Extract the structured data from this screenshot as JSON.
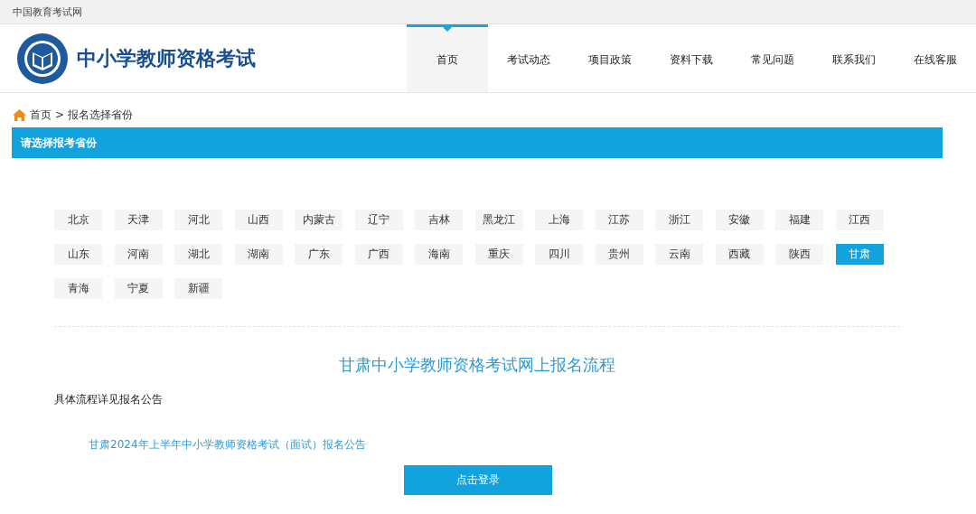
{
  "top_bar": {
    "site_name": "中国教育考试网"
  },
  "header": {
    "title": "中小学教师资格考试"
  },
  "nav": [
    {
      "label": "首页",
      "selected": true
    },
    {
      "label": "考试动态",
      "selected": false
    },
    {
      "label": "项目政策",
      "selected": false
    },
    {
      "label": "资料下载",
      "selected": false
    },
    {
      "label": "常见问题",
      "selected": false
    },
    {
      "label": "联系我们",
      "selected": false
    },
    {
      "label": "在线客服",
      "selected": false
    }
  ],
  "breadcrumb": {
    "home": "首页",
    "separator": ">",
    "current": "报名选择省份"
  },
  "panel": {
    "title": "请选择报考省份"
  },
  "provinces": [
    {
      "label": "北京",
      "selected": false
    },
    {
      "label": "天津",
      "selected": false
    },
    {
      "label": "河北",
      "selected": false
    },
    {
      "label": "山西",
      "selected": false
    },
    {
      "label": "内蒙古",
      "selected": false
    },
    {
      "label": "辽宁",
      "selected": false
    },
    {
      "label": "吉林",
      "selected": false
    },
    {
      "label": "黑龙江",
      "selected": false
    },
    {
      "label": "上海",
      "selected": false
    },
    {
      "label": "江苏",
      "selected": false
    },
    {
      "label": "浙江",
      "selected": false
    },
    {
      "label": "安徽",
      "selected": false
    },
    {
      "label": "福建",
      "selected": false
    },
    {
      "label": "江西",
      "selected": false
    },
    {
      "label": "山东",
      "selected": false
    },
    {
      "label": "河南",
      "selected": false
    },
    {
      "label": "湖北",
      "selected": false
    },
    {
      "label": "湖南",
      "selected": false
    },
    {
      "label": "广东",
      "selected": false
    },
    {
      "label": "广西",
      "selected": false
    },
    {
      "label": "海南",
      "selected": false
    },
    {
      "label": "重庆",
      "selected": false
    },
    {
      "label": "四川",
      "selected": false
    },
    {
      "label": "贵州",
      "selected": false
    },
    {
      "label": "云南",
      "selected": false
    },
    {
      "label": "西藏",
      "selected": false
    },
    {
      "label": "陕西",
      "selected": false
    },
    {
      "label": "甘肃",
      "selected": true
    },
    {
      "label": "青海",
      "selected": false
    },
    {
      "label": "宁夏",
      "selected": false
    },
    {
      "label": "新疆",
      "selected": false
    }
  ],
  "process": {
    "heading": "甘肃中小学教师资格考试网上报名流程",
    "note": "具体流程详见报名公告",
    "link": "甘肃2024年上半年中小学教师资格考试（面试）报名公告",
    "button": "点击登录"
  }
}
